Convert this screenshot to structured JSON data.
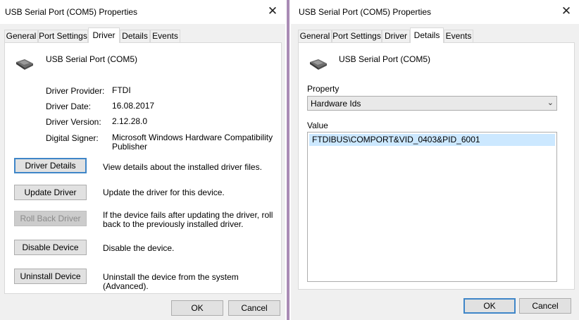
{
  "left_dialog": {
    "title": "USB Serial Port (COM5) Properties",
    "tabs": [
      "General",
      "Port Settings",
      "Driver",
      "Details",
      "Events"
    ],
    "active_tab": "Driver",
    "device_name": "USB Serial Port (COM5)",
    "driver_info": {
      "provider_label": "Driver Provider:",
      "provider_value": "FTDI",
      "date_label": "Driver Date:",
      "date_value": "16.08.2017",
      "version_label": "Driver Version:",
      "version_value": "2.12.28.0",
      "signer_label": "Digital Signer:",
      "signer_value_line1": "Microsoft Windows Hardware Compatibility",
      "signer_value_line2": "Publisher"
    },
    "actions": {
      "details_label": "Driver Details",
      "details_desc": "View details about the installed driver files.",
      "update_label": "Update Driver",
      "update_desc": "Update the driver for this device.",
      "rollback_label": "Roll Back Driver",
      "rollback_desc_line1": "If the device fails after updating the driver, roll",
      "rollback_desc_line2": "back to the previously installed driver.",
      "disable_label": "Disable Device",
      "disable_desc": "Disable the device.",
      "uninstall_label": "Uninstall Device",
      "uninstall_desc": "Uninstall the device from the system (Advanced)."
    },
    "ok_label": "OK",
    "cancel_label": "Cancel"
  },
  "right_dialog": {
    "title": "USB Serial Port (COM5) Properties",
    "tabs": [
      "General",
      "Port Settings",
      "Driver",
      "Details",
      "Events"
    ],
    "active_tab": "Details",
    "device_name": "USB Serial Port (COM5)",
    "property_label": "Property",
    "property_selected": "Hardware Ids",
    "value_label": "Value",
    "values": [
      "FTDIBUS\\COMPORT&VID_0403&PID_6001"
    ],
    "ok_label": "OK",
    "cancel_label": "Cancel"
  },
  "icons": {
    "close": "close-icon",
    "device": "usb-serial-connector-icon",
    "dropdown": "chevron-down-icon"
  },
  "colors": {
    "dialog_bg": "#f0f0f0",
    "focus_border": "#3f86c8",
    "selection": "#cce8ff",
    "splitter": "#a98bb5"
  }
}
